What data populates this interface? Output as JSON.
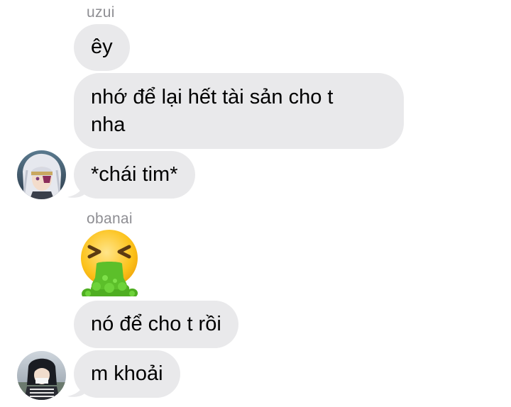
{
  "conversation": {
    "groups": [
      {
        "sender": "uzui",
        "messages": [
          {
            "text": "êy"
          },
          {
            "text_lines": [
              "nhớ để lại hết tài sản cho t",
              "nha"
            ]
          },
          {
            "text": "*chái tim*"
          }
        ]
      },
      {
        "sender": "obanai",
        "messages": [
          {
            "emoji": "face-vomiting-emoji"
          },
          {
            "text": "nó để cho t rồi"
          },
          {
            "text": "m khoải"
          }
        ]
      }
    ]
  },
  "theme": {
    "bubble_color": "#e9e9eb",
    "sender_color": "#8e8e93",
    "text_color": "#000000",
    "background": "#ffffff"
  }
}
